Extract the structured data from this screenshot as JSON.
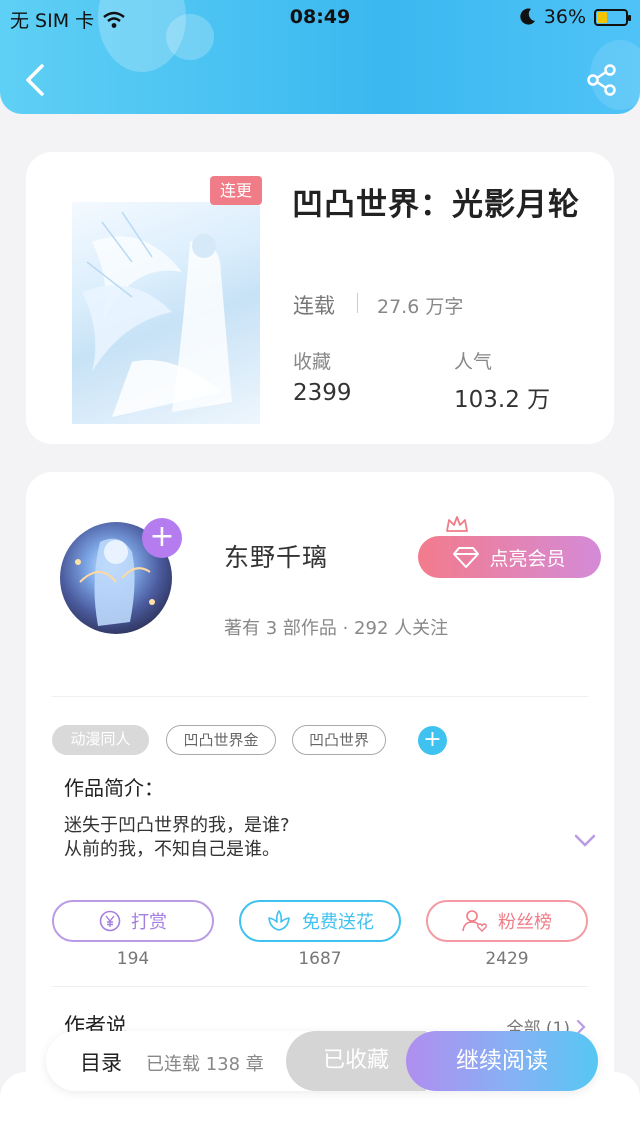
{
  "status_bar": {
    "carrier": "无 SIM 卡",
    "time": "08:49",
    "battery": "36%",
    "battery_level": 0.36
  },
  "header": {
    "back_icon": "chevron-left-icon",
    "share_icon": "share-icon",
    "gradient_colors": [
      "#5fd0f5",
      "#3bb8f0"
    ]
  },
  "book": {
    "tag": "连更",
    "title": "凹凸世界：光影月轮",
    "status": "连载",
    "word_count": "27.6 万字",
    "stats": {
      "collect_label": "收藏",
      "collect_value": "2399",
      "popularity_label": "人气",
      "popularity_value": "103.2 万"
    }
  },
  "author": {
    "name": "东野千璃",
    "follow_icon": "plus-icon",
    "vip_button": "点亮会员",
    "meta": "著有 3 部作品 · 292 人关注"
  },
  "tags": [
    "动漫同人",
    "凹凸世界金",
    "凹凸世界"
  ],
  "intro": {
    "label": "作品简介：",
    "line1": "迷失于凹凸世界的我，是谁?",
    "line2": "从前的我，不知自己是谁。"
  },
  "actions": [
    {
      "label": "打赏",
      "count": "194",
      "icon": "yen-icon",
      "color": "#a57fe0"
    },
    {
      "label": "免费送花",
      "count": "1687",
      "icon": "flower-icon",
      "color": "#3fc2f0"
    },
    {
      "label": "粉丝榜",
      "count": "2429",
      "icon": "fan-user-icon",
      "color": "#f07c87"
    }
  ],
  "author_say": {
    "label": "作者说",
    "all": "全部 (1)"
  },
  "bottom_bar": {
    "catalog": "目录",
    "chapters": "已连载 138 章",
    "collected": "已收藏",
    "continue": "继续阅读"
  }
}
